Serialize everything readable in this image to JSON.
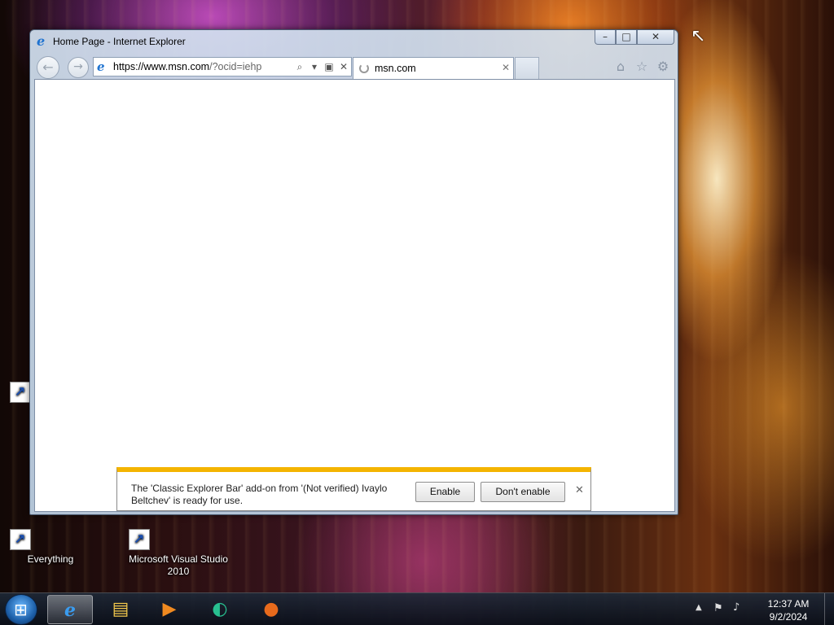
{
  "window": {
    "title": "Home Page - Internet Explorer",
    "min_glyph": "–",
    "max_glyph": "□",
    "close_glyph": "✕"
  },
  "navbar": {
    "back_glyph": "←",
    "forward_glyph": "→",
    "address": {
      "url_main": "https://www.msn.com",
      "url_tail": "/?ocid=iehp",
      "search_glyph": "⌕",
      "dropdown_glyph": "▾",
      "lock_glyph": "▣",
      "stop_glyph": "✕"
    },
    "tab": {
      "title": "msn.com",
      "close_glyph": "✕"
    },
    "command_icons": [
      "home-icon",
      "favorites-star-icon",
      "tools-gear-icon"
    ],
    "home_glyph": "⌂",
    "star_glyph": "☆",
    "gear_glyph": "⚙"
  },
  "notification": {
    "message": "The 'Classic Explorer Bar' add-on from '(Not verified) Ivaylo Beltchev' is ready for use.",
    "enable_label": "Enable",
    "dont_enable_label": "Don't enable",
    "close_glyph": "✕"
  },
  "desktop": {
    "icons": [
      {
        "label": "Everything"
      },
      {
        "label": "Microsoft Visual Studio 2010"
      }
    ]
  },
  "taskbar": {
    "pinned": [
      "internet-explorer",
      "windows-explorer",
      "windows-media-player",
      "globe-app",
      "firefox"
    ],
    "ie_glyph": "e",
    "explorer_glyph": "▤",
    "media_glyph": "▶",
    "globe_glyph": "◐",
    "firefox_glyph": "●",
    "tray": {
      "up_glyph": "▲",
      "flag_glyph": "⚑",
      "volume_glyph": "♪",
      "time": "12:37 AM",
      "date": "9/2/2024"
    }
  },
  "colors": {
    "notification_accent": "#f4b400",
    "ie_blue": "#1f73d0"
  }
}
